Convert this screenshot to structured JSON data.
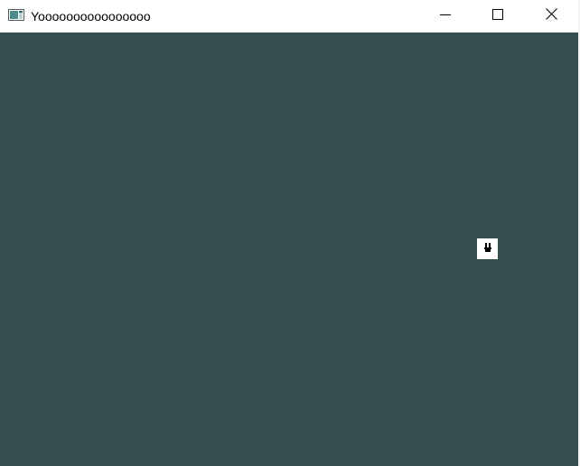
{
  "window": {
    "title": "Yoooooooooooooooo",
    "controls": {
      "minimize_icon": "minimize-icon",
      "maximize_icon": "maximize-icon",
      "close_icon": "close-icon"
    }
  },
  "canvas": {
    "background": "#344e4e",
    "sprite": {
      "icon": "smiley-face-icon",
      "color": "#ffffff"
    }
  }
}
